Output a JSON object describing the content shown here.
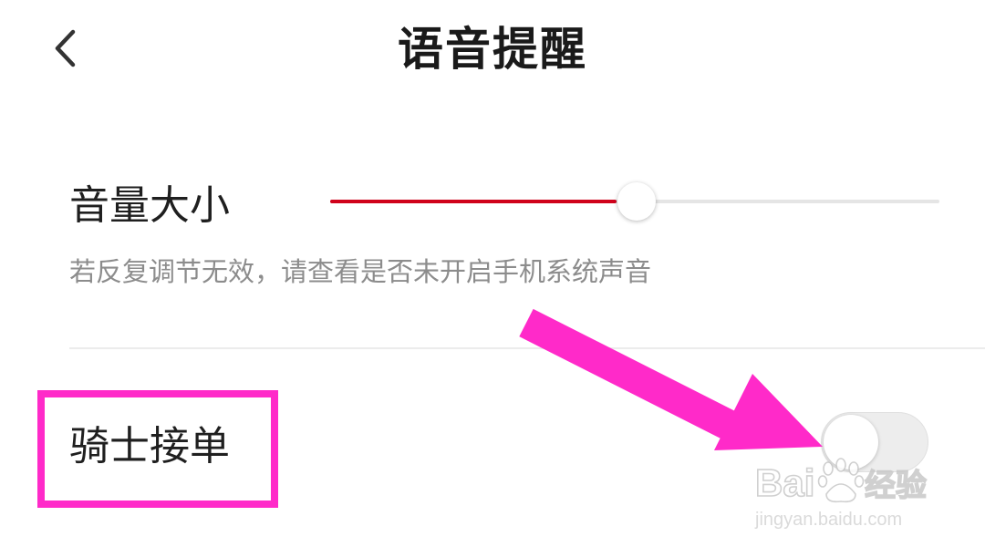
{
  "header": {
    "title": "语音提醒",
    "back_icon": "chevron-left-icon"
  },
  "volume": {
    "label": "音量大小",
    "level_fraction": 0.47,
    "hint": "若反复调节无效，请查看是否未开启手机系统声音"
  },
  "rider_order": {
    "label": "骑士接单",
    "enabled": false
  },
  "colors": {
    "accent": "#d0021b",
    "annotation": "#ff2ac9",
    "track": "#e5e5e5",
    "hint_text": "#8c8c8c"
  },
  "watermark": {
    "logo_text": "Baidu经验",
    "url_text": "jingyan.baidu.com"
  }
}
